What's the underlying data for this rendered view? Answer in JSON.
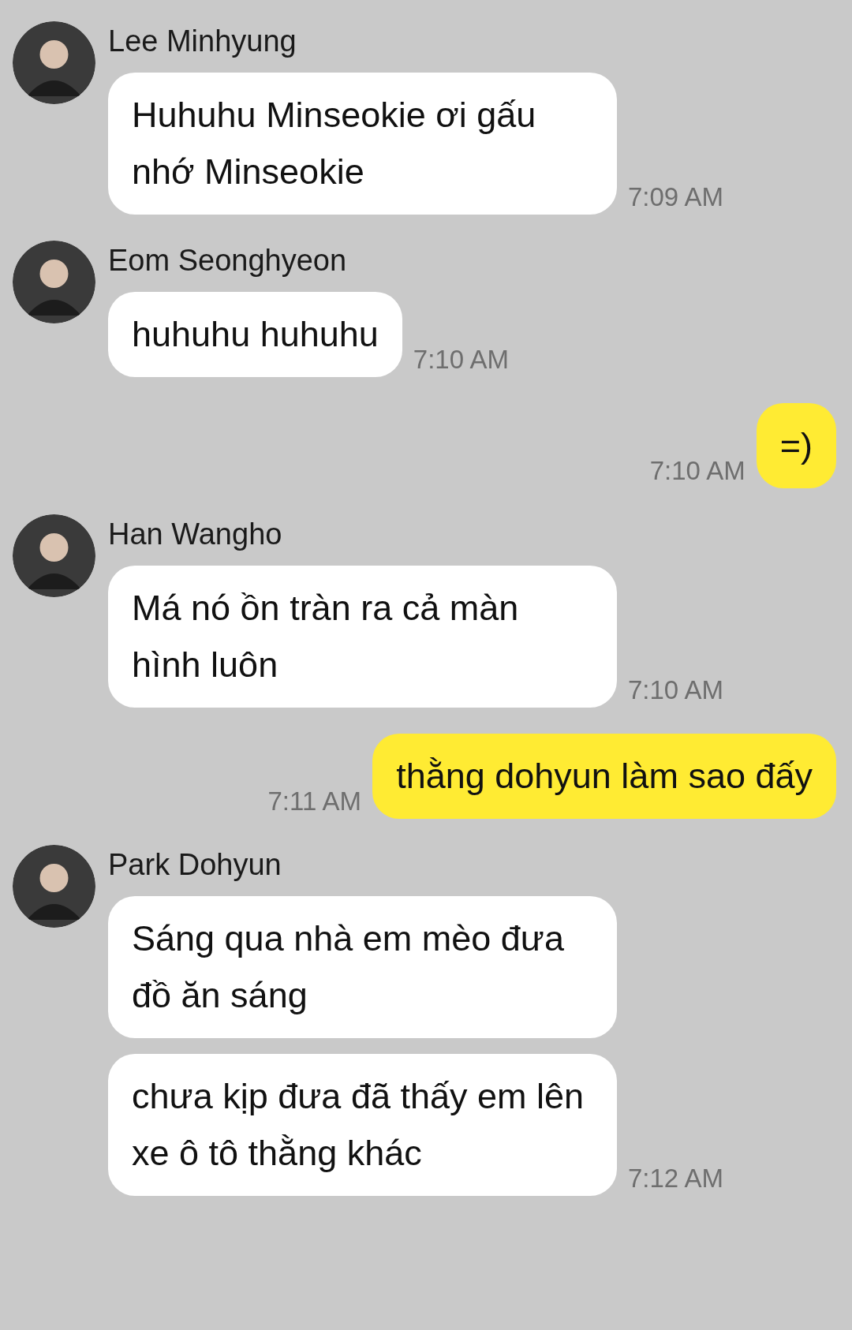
{
  "messages": [
    {
      "kind": "incoming",
      "sender": "Lee Minhyung",
      "bubbles": [
        "Huhuhu Minseokie ơi gấu nhớ Minseokie"
      ],
      "time": "7:09 AM"
    },
    {
      "kind": "incoming",
      "sender": "Eom Seonghyeon",
      "bubbles": [
        "huhuhu huhuhu"
      ],
      "time": "7:10 AM"
    },
    {
      "kind": "outgoing",
      "bubbles": [
        "=)"
      ],
      "time": "7:10 AM"
    },
    {
      "kind": "incoming",
      "sender": "Han Wangho",
      "bubbles": [
        "Má nó ồn tràn ra cả màn hình luôn"
      ],
      "time": "7:10 AM"
    },
    {
      "kind": "outgoing",
      "bubbles": [
        "thằng dohyun làm sao đấy"
      ],
      "time": "7:11 AM"
    },
    {
      "kind": "incoming",
      "sender": "Park Dohyun",
      "bubbles": [
        "Sáng qua nhà em mèo đưa đồ ăn sáng",
        "chưa kịp đưa đã thấy em lên xe ô tô thằng khác"
      ],
      "time": "7:12 AM"
    }
  ]
}
